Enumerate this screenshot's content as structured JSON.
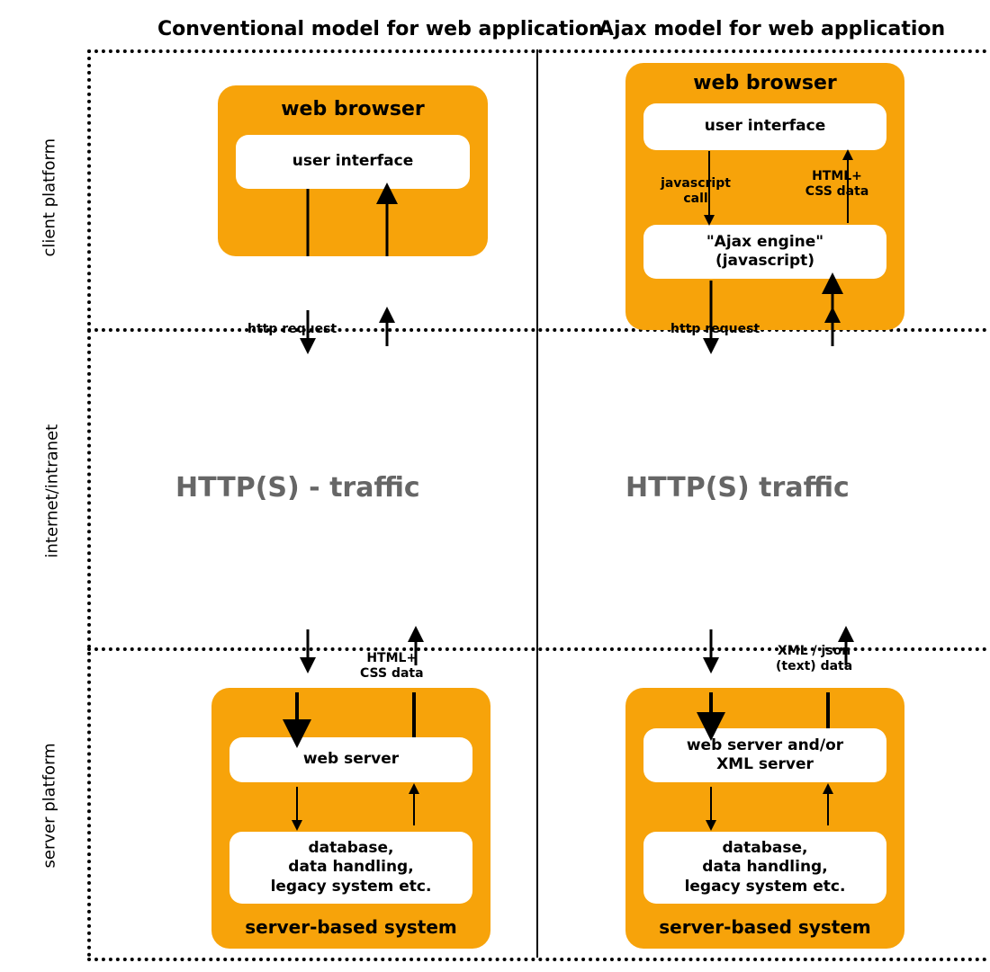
{
  "rows": {
    "client": "client platform",
    "internet": "internet/intranet",
    "server": "server platform"
  },
  "cols": {
    "left": "Conventional model for web application",
    "right": "Ajax model for web application"
  },
  "leftClient": {
    "title": "web browser",
    "ui": "user interface"
  },
  "rightClient": {
    "title": "web browser",
    "ui": "user interface",
    "arrow_left": "javascript\ncall",
    "arrow_right": "HTML+\nCSS data",
    "engine": "\"Ajax engine\"\n(javascript)"
  },
  "traffic": {
    "left": "HTTP(S) - traffic",
    "right": "HTTP(S) traffic"
  },
  "boundaryLeft": {
    "top": "http request",
    "bottom_down": "",
    "bottom_label": "HTML+\nCSS data"
  },
  "boundaryRight": {
    "top": "http request",
    "bottom_down": "",
    "bottom_label": "XML / json\n(text) data"
  },
  "leftServer": {
    "title": "server-based system",
    "web": "web server",
    "db": "database,\ndata handling,\nlegacy system etc."
  },
  "rightServer": {
    "title": "server-based system",
    "web": "web server and/or\nXML server",
    "db": "database,\ndata handling,\nlegacy system etc."
  }
}
